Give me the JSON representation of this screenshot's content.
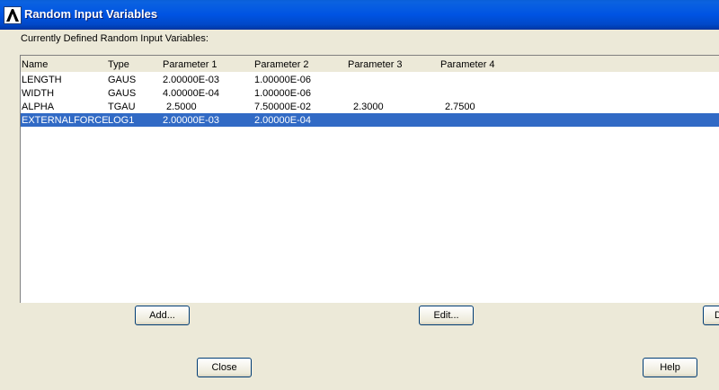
{
  "window": {
    "title": "Random Input Variables"
  },
  "section_label": "Currently Defined Random Input Variables:",
  "table": {
    "columns": [
      "Name",
      "Type",
      "Parameter 1",
      "Parameter 2",
      "Parameter 3",
      "Parameter 4"
    ],
    "rows": [
      [
        "LENGTH",
        "GAUS",
        "2.00000E-03",
        "1.00000E-06",
        "",
        ""
      ],
      [
        "WIDTH",
        "GAUS",
        "4.00000E-04",
        "1.00000E-06",
        "",
        ""
      ],
      [
        "ALPHA",
        "TGAU",
        "2.5000",
        "7.50000E-02",
        "2.3000",
        "2.7500"
      ],
      [
        "EXTERNALFORCE",
        "LOG1",
        "2.00000E-03",
        "2.00000E-04",
        "",
        ""
      ]
    ],
    "selected_row": 3
  },
  "buttons": {
    "add": "Add...",
    "edit": "Edit...",
    "delete": "D",
    "close": "Close",
    "help": "Help"
  },
  "colors": {
    "titlebar": "#0054e3",
    "selection": "#316ac5",
    "window_bg": "#ece9d8"
  }
}
